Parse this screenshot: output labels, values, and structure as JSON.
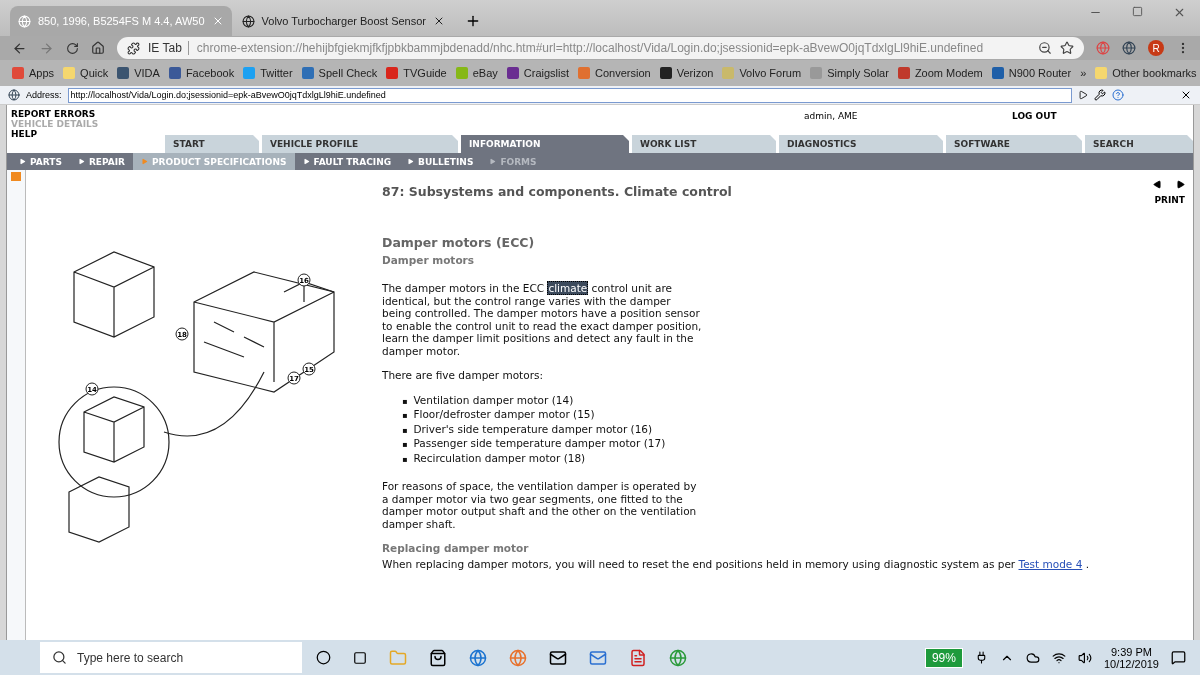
{
  "browser": {
    "tabs": [
      {
        "title": "850, 1996, B5254FS M 4.4, AW50",
        "selected": true
      },
      {
        "title": "Volvo Turbocharger Boost Sensor",
        "selected": false
      }
    ],
    "omnibox": {
      "chip": "IE Tab",
      "url": "chrome-extension://hehijbfgiekmjfkfjpbkbammjbdenadd/nhc.htm#url=http://localhost/Vida/Login.do;jsessionid=epk-aBvewO0jqTdxlgLl9hiE.undefined"
    },
    "profile_initial": "R",
    "bookmarks": [
      {
        "label": "Apps",
        "color": "#e04a3a"
      },
      {
        "label": "Quick",
        "color": "#f5d76e"
      },
      {
        "label": "VIDA",
        "color": "#3b5470"
      },
      {
        "label": "Facebook",
        "color": "#3b5998"
      },
      {
        "label": "Twitter",
        "color": "#1da1f2"
      },
      {
        "label": "Spell Check",
        "color": "#2f6fb5"
      },
      {
        "label": "TVGuide",
        "color": "#d9261c"
      },
      {
        "label": "eBay",
        "color": "#86b817"
      },
      {
        "label": "Craigslist",
        "color": "#6a2d91"
      },
      {
        "label": "Conversion",
        "color": "#e07030"
      },
      {
        "label": "Verizon",
        "color": "#222222"
      },
      {
        "label": "Volvo Forum",
        "color": "#c9b96a"
      },
      {
        "label": "Simply Solar",
        "color": "#999999"
      },
      {
        "label": "Zoom Modem",
        "color": "#c0392b"
      },
      {
        "label": "N900 Router",
        "color": "#1f5fa8"
      }
    ],
    "more_bookmarks": "»",
    "other_bookmarks": "Other bookmarks",
    "ie_address": {
      "label": "Address:",
      "value": "http://localhost/Vida/Login.do;jsessionid=epk-aBvewO0jqTdxlgLl9hiE.undefined"
    }
  },
  "app": {
    "side_links": [
      {
        "label": "REPORT ERRORS",
        "disabled": false
      },
      {
        "label": "VEHICLE DETAILS",
        "disabled": true
      },
      {
        "label": "HELP",
        "disabled": false
      }
    ],
    "user": "admin, AME",
    "logout": "LOG OUT",
    "main_tabs": [
      {
        "label": "START",
        "selected": false
      },
      {
        "label": "VEHICLE PROFILE",
        "selected": false
      },
      {
        "label": "INFORMATION",
        "selected": true
      },
      {
        "label": "WORK LIST",
        "selected": false
      },
      {
        "label": "DIAGNOSTICS",
        "selected": false
      },
      {
        "label": "SOFTWARE",
        "selected": false
      },
      {
        "label": "SEARCH",
        "selected": false
      }
    ],
    "sub_tabs": [
      {
        "label": "PARTS",
        "selected": false,
        "disabled": false
      },
      {
        "label": "REPAIR",
        "selected": false,
        "disabled": false
      },
      {
        "label": "PRODUCT SPECIFICATIONS",
        "selected": true,
        "disabled": false
      },
      {
        "label": "FAULT TRACING",
        "selected": false,
        "disabled": false
      },
      {
        "label": "BULLETINS",
        "selected": false,
        "disabled": false
      },
      {
        "label": "FORMS",
        "selected": false,
        "disabled": true
      }
    ],
    "print": "PRINT",
    "document": {
      "title": "87: Subsystems and components. Climate control",
      "heading": "Damper motors (ECC)",
      "subheading": "Damper motors",
      "paragraph_1": "The damper motors in the ECC **climate** control unit are identical, but the control range varies with the damper being controlled. The damper motors have a position sensor to enable the control unit to read the exact damper position, learn the damper limit positions and detect any fault in the damper motor.",
      "paragraph_2": "There are five damper motors:",
      "bullet": "▪",
      "list": [
        "Ventilation damper motor (14)",
        "Floor/defroster damper motor (15)",
        "Driver's side temperature damper motor (16)",
        "Passenger side temperature damper motor (17)",
        "Recirculation damper motor (18)"
      ],
      "paragraph_3": "For reasons of space, the ventilation damper is operated by a damper motor via two gear segments, one fitted to the damper motor output shaft and the other on the ventilation damper shaft.",
      "section": "Replacing damper motor",
      "paragraph_4": {
        "before": "When replacing damper motors, you will need to reset the end positions held in memory using diagnostic system as per",
        "link": "Test mode 4",
        "after": "."
      },
      "callouts": [
        "16",
        "18",
        "17",
        "15",
        "14"
      ]
    }
  },
  "taskbar": {
    "search_placeholder": "Type here to search",
    "battery": "99%",
    "time": "9:39 PM",
    "date": "10/12/2019"
  }
}
